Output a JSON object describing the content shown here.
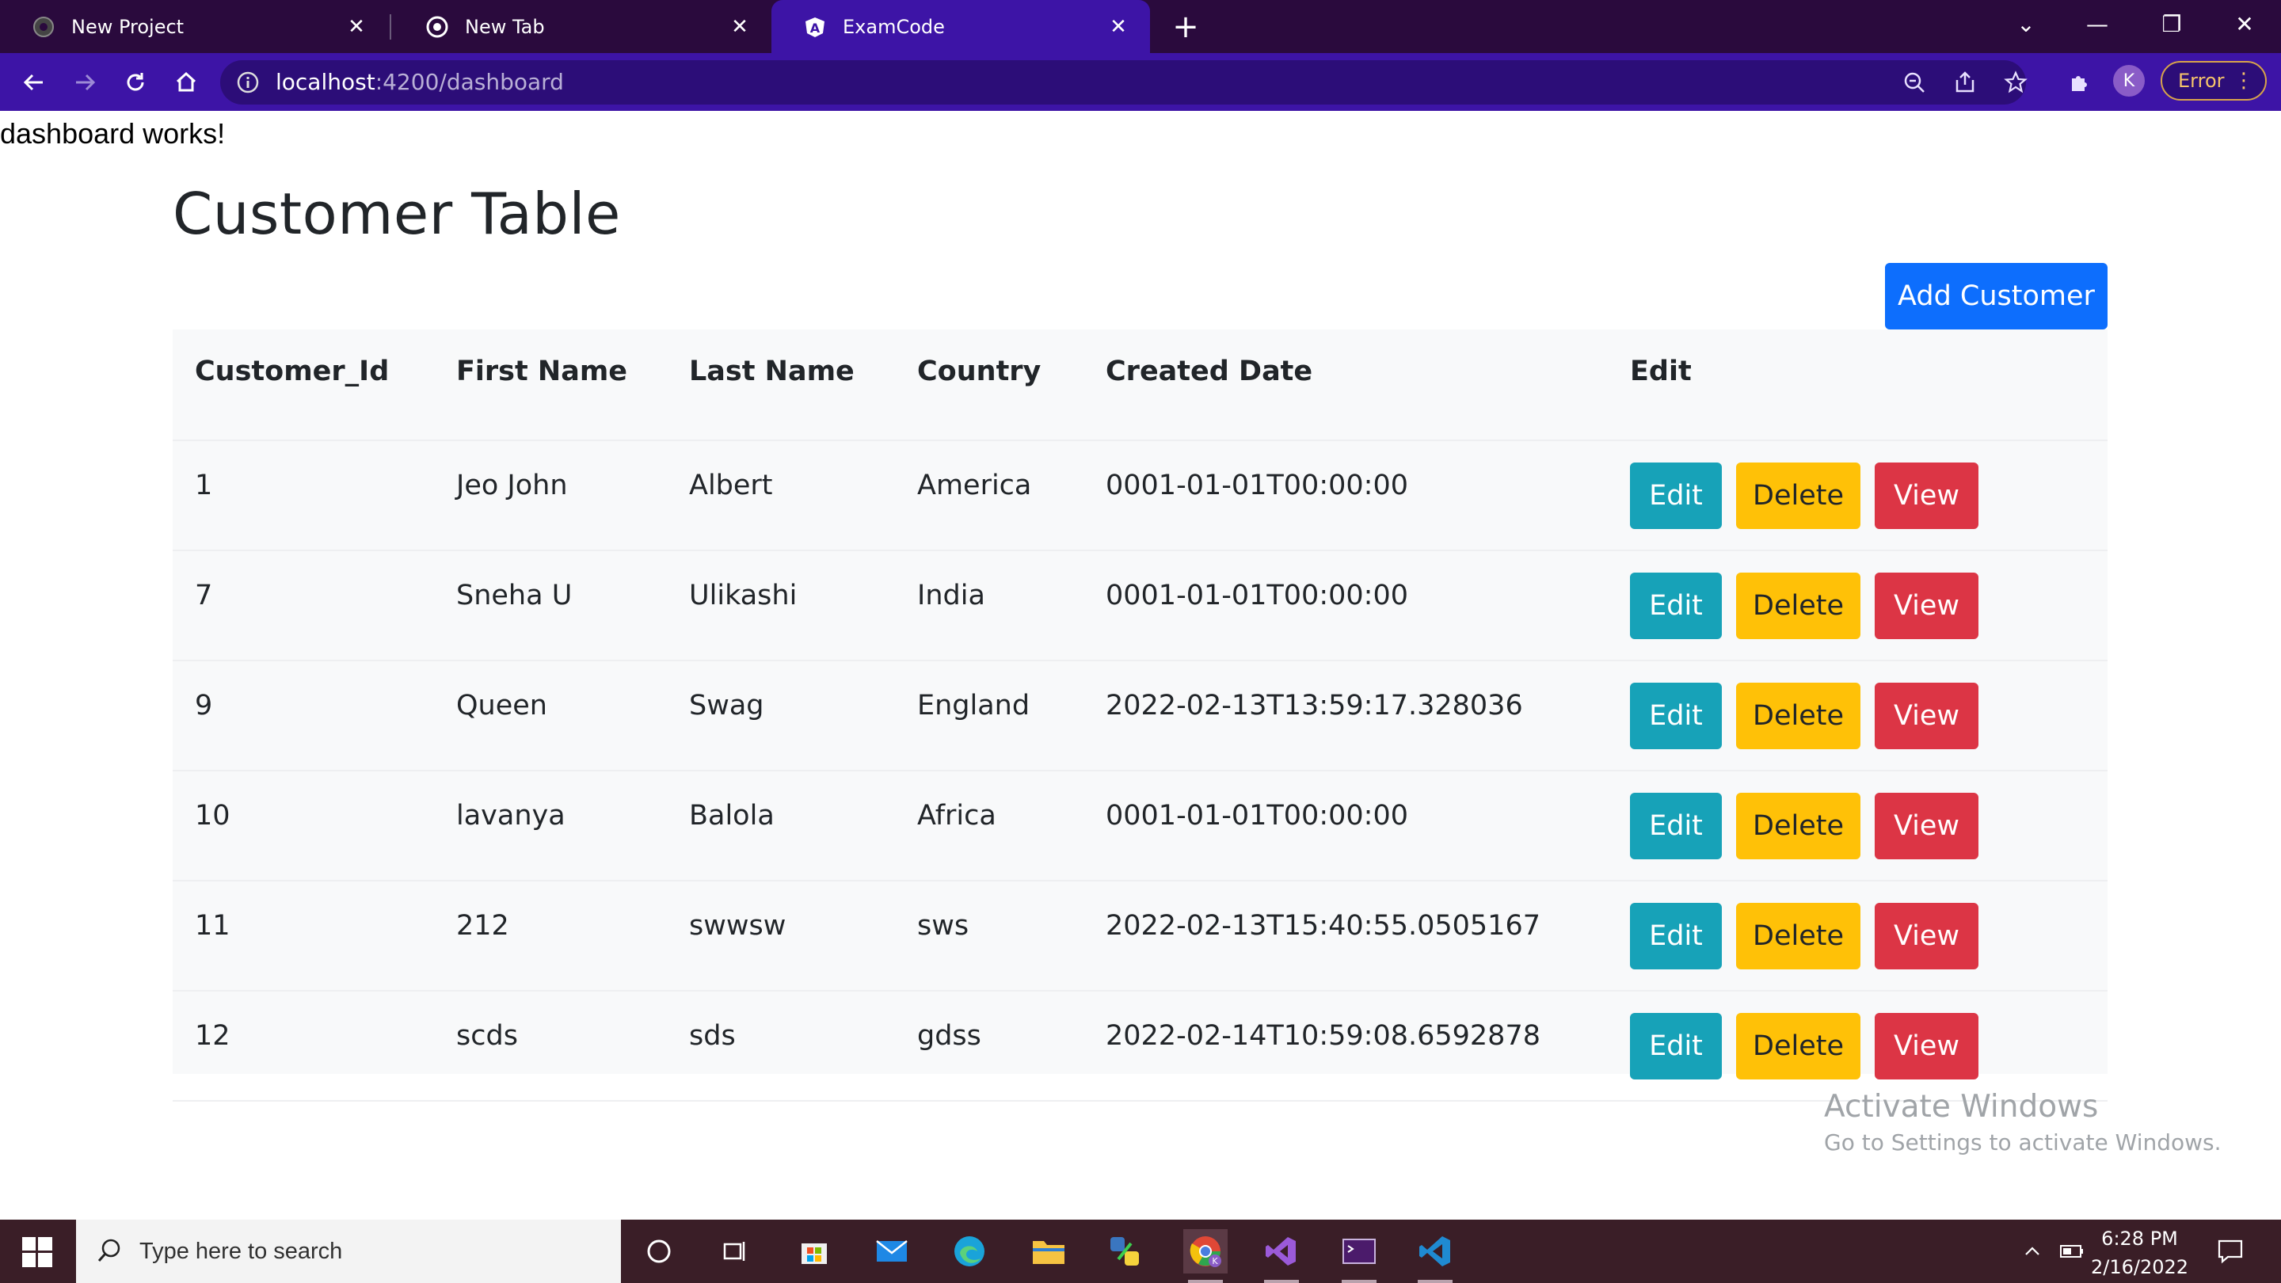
{
  "browser": {
    "tabs": [
      {
        "title": "New Project",
        "icon": "github-icon"
      },
      {
        "title": "New Tab",
        "icon": "chrome-icon"
      },
      {
        "title": "ExamCode",
        "icon": "angular-icon",
        "active": true
      }
    ],
    "url_host": "localhost",
    "url_rest": ":4200/dashboard",
    "profile_initial": "K",
    "error_label": "Error"
  },
  "page": {
    "status_text": "dashboard works!",
    "heading": "Customer Table",
    "add_button": "Add Customer"
  },
  "table": {
    "columns": [
      "Customer_Id",
      "First Name",
      "Last Name",
      "Country",
      "Created Date",
      "Edit"
    ],
    "rows": [
      {
        "id": "1",
        "first": "Jeo John",
        "last": "Albert",
        "country": "America",
        "created": "0001-01-01T00:00:00"
      },
      {
        "id": "7",
        "first": "Sneha U",
        "last": "Ulikashi",
        "country": "India",
        "created": "0001-01-01T00:00:00"
      },
      {
        "id": "9",
        "first": "Queen",
        "last": "Swag",
        "country": "England",
        "created": "2022-02-13T13:59:17.328036"
      },
      {
        "id": "10",
        "first": "lavanya",
        "last": "Balola",
        "country": "Africa",
        "created": "0001-01-01T00:00:00"
      },
      {
        "id": "11",
        "first": "212",
        "last": "swwsw",
        "country": "sws",
        "created": "2022-02-13T15:40:55.0505167"
      },
      {
        "id": "12",
        "first": "scds",
        "last": "sds",
        "country": "gdss",
        "created": "2022-02-14T10:59:08.6592878"
      }
    ],
    "actions": {
      "edit": "Edit",
      "delete": "Delete",
      "view": "View"
    }
  },
  "watermark": {
    "line1": "Activate Windows",
    "line2": "Go to Settings to activate Windows."
  },
  "taskbar": {
    "search_placeholder": "Type here to search",
    "time": "6:28 PM",
    "date": "2/16/2022"
  },
  "colors": {
    "primary": "#0d6efd",
    "info": "#17a2b8",
    "warning": "#ffc107",
    "danger": "#dc3545",
    "browser_frame": "#3d14a6",
    "taskbar": "#3a1e27"
  }
}
